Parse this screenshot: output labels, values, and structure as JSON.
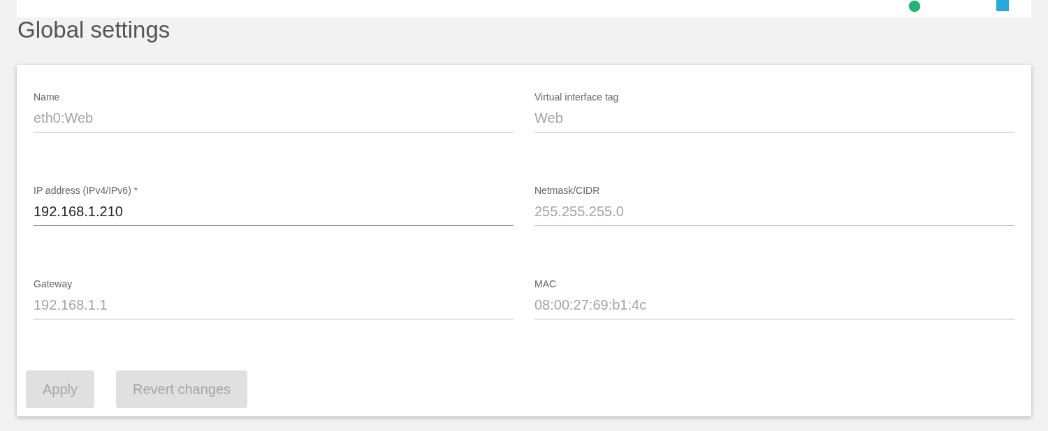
{
  "title": "Global settings",
  "fields": [
    {
      "label": "Name",
      "value": "eth0:Web",
      "disabled": true
    },
    {
      "label": "Virtual interface tag",
      "value": "Web",
      "disabled": true
    },
    {
      "label": "IP address (IPv4/IPv6) *",
      "value": "192.168.1.210",
      "disabled": false
    },
    {
      "label": "Netmask/CIDR",
      "value": "255.255.255.0",
      "disabled": true
    },
    {
      "label": "Gateway",
      "value": "192.168.1.1",
      "disabled": true
    },
    {
      "label": "MAC",
      "value": "08:00:27:69:b1:4c",
      "disabled": true
    }
  ],
  "buttons": [
    {
      "label": "Apply",
      "disabled": true
    },
    {
      "label": "Revert changes",
      "disabled": true
    }
  ]
}
